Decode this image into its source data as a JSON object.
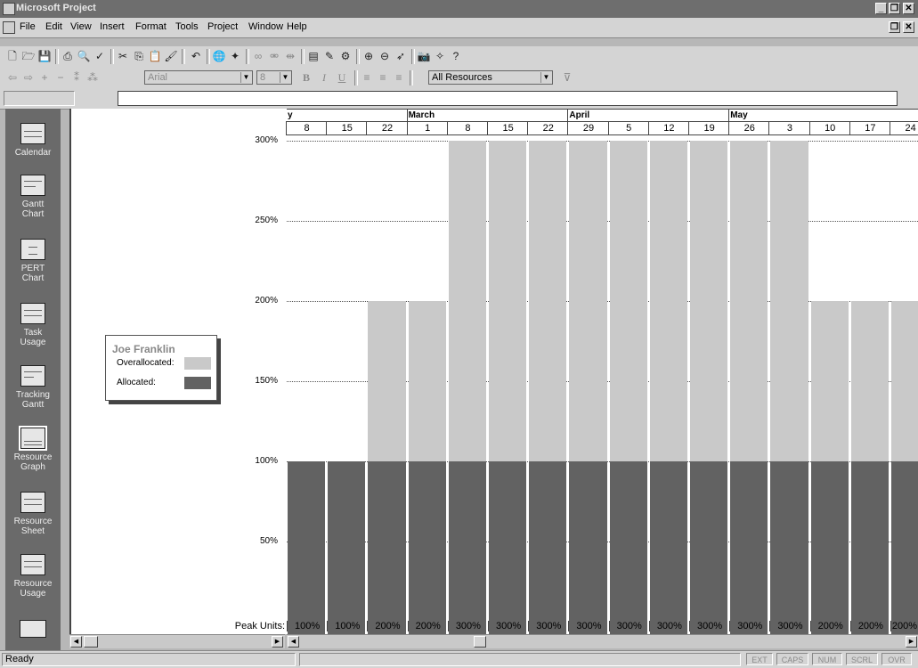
{
  "window": {
    "title": "Microsoft Project",
    "min_label": "_",
    "max_label": "❐",
    "close_label": "✕"
  },
  "menu": [
    "File",
    "Edit",
    "View",
    "Insert",
    "Format",
    "Tools",
    "Project",
    "Window",
    "Help"
  ],
  "formatting": {
    "font": "Arial",
    "size": "8",
    "filter": "All Resources",
    "bold": "B",
    "italic": "I",
    "underline": "U"
  },
  "viewbar": [
    {
      "label": "Calendar"
    },
    {
      "label": "Gantt Chart"
    },
    {
      "label": "PERT Chart"
    },
    {
      "label": "Task Usage"
    },
    {
      "label": "Tracking Gantt"
    },
    {
      "label": "Resource Graph"
    },
    {
      "label": "Resource Sheet"
    },
    {
      "label": "Resource Usage"
    }
  ],
  "legend": {
    "name": "Joe Franklin",
    "over_label": "Overallocated:",
    "alloc_label": "Allocated:"
  },
  "timescale": {
    "months": [
      {
        "label": "y",
        "start": 0
      },
      {
        "label": "March",
        "start": 3
      },
      {
        "label": "April",
        "start": 7
      },
      {
        "label": "May",
        "start": 11
      }
    ],
    "days": [
      "8",
      "15",
      "22",
      "1",
      "8",
      "15",
      "22",
      "29",
      "5",
      "12",
      "19",
      "26",
      "3",
      "10",
      "17",
      "24"
    ]
  },
  "colors": {
    "overallocated": "#c9c9c9",
    "allocated": "#626262"
  },
  "chart_data": {
    "type": "bar",
    "title": "",
    "ylabel": "",
    "y_tick_labels": [
      "300%",
      "250%",
      "200%",
      "150%",
      "100%",
      "50%"
    ],
    "ylim": [
      0,
      300
    ],
    "categories": [
      "8",
      "15",
      "22",
      "1",
      "8",
      "15",
      "22",
      "29",
      "5",
      "12",
      "19",
      "26",
      "3",
      "10",
      "17",
      "24"
    ],
    "series": [
      {
        "name": "Allocated",
        "values": [
          100,
          100,
          100,
          100,
          100,
          100,
          100,
          100,
          100,
          100,
          100,
          100,
          100,
          100,
          100,
          100
        ]
      },
      {
        "name": "Overallocated",
        "values": [
          0,
          0,
          100,
          100,
          200,
          200,
          200,
          200,
          200,
          200,
          200,
          200,
          200,
          100,
          100,
          100
        ]
      }
    ],
    "peak_units_label": "Peak Units:",
    "peak_units": [
      "100%",
      "100%",
      "200%",
      "200%",
      "300%",
      "300%",
      "300%",
      "300%",
      "300%",
      "300%",
      "300%",
      "300%",
      "300%",
      "200%",
      "200%",
      "200%"
    ]
  },
  "status": {
    "text": "Ready",
    "indicators": [
      "EXT",
      "CAPS",
      "NUM",
      "SCRL",
      "OVR"
    ]
  }
}
